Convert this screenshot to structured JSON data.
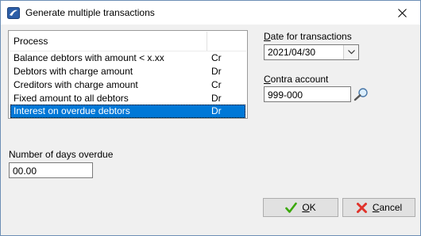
{
  "window": {
    "title": "Generate multiple transactions"
  },
  "list": {
    "header": "Process",
    "rows": [
      {
        "process": "Balance debtors with amount < x.xx",
        "type": "Cr",
        "selected": false
      },
      {
        "process": "Debtors with charge amount",
        "type": "Dr",
        "selected": false
      },
      {
        "process": "Creditors with charge amount",
        "type": "Cr",
        "selected": false
      },
      {
        "process": "Fixed amount to all debtors",
        "type": "Dr",
        "selected": false
      },
      {
        "process": "Interest on overdue debtors",
        "type": "Dr",
        "selected": true
      }
    ]
  },
  "date": {
    "label_first": "D",
    "label_rest": "ate for transactions",
    "value": "2021/04/30"
  },
  "contra": {
    "label_first": "C",
    "label_rest": "ontra account",
    "value": "999-000"
  },
  "days": {
    "label": "Number of days overdue",
    "value": "00.00"
  },
  "buttons": {
    "ok_first": "O",
    "ok_rest": "K",
    "cancel_first": "C",
    "cancel_rest": "ancel"
  },
  "colors": {
    "selection": "#0078d7",
    "ok_check": "#3aa80b",
    "cancel_x": "#e0332b"
  },
  "icons": [
    "app-icon",
    "close-icon",
    "chevron-down-icon",
    "magnifier-icon",
    "checkmark-icon",
    "cancel-x-icon"
  ]
}
